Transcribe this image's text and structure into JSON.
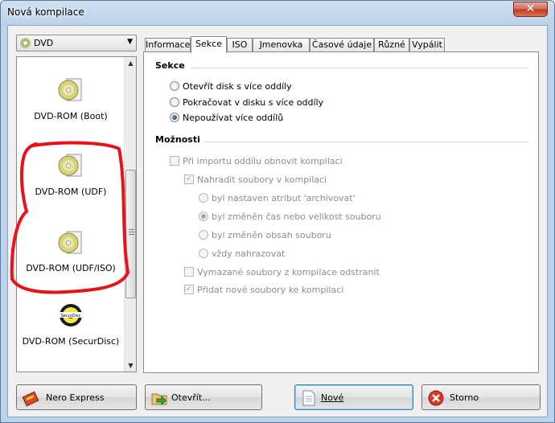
{
  "window": {
    "title": "Nová kompilace"
  },
  "left_panel": {
    "dropdown_value": "DVD",
    "items": [
      {
        "label": "DVD-ROM (Boot)",
        "icon": "dvd-disc-icon"
      },
      {
        "label": "DVD-ROM (UDF)",
        "icon": "dvd-disc-icon"
      },
      {
        "label": "DVD-ROM (UDF/ISO)",
        "icon": "dvd-disc-icon"
      },
      {
        "label": "DVD-ROM (SecurDisc)",
        "icon": "securdisc-icon",
        "icon_text": "SecurDisc"
      }
    ]
  },
  "tabs": [
    {
      "label": "Informace",
      "active": false
    },
    {
      "label": "Sekce",
      "active": true
    },
    {
      "label": "ISO",
      "active": false
    },
    {
      "label": "Jmenovka",
      "active": false
    },
    {
      "label": "Časové údaje",
      "active": false
    },
    {
      "label": "Různé",
      "active": false
    },
    {
      "label": "Vypálit",
      "active": false
    }
  ],
  "sekce": {
    "title": "Sekce",
    "options": [
      {
        "label": "Otevřít disk s více oddíly",
        "checked": false
      },
      {
        "label": "Pokračovat v disku s více oddíly",
        "checked": false
      },
      {
        "label": "Nepoužívat více oddílů",
        "checked": true
      }
    ]
  },
  "moznosti": {
    "title": "Možnosti",
    "import_checkbox": {
      "label": "Při importu oddílu obnovit kompilaci",
      "checked": false,
      "enabled": false
    },
    "replace_checkbox": {
      "label": "Nahradit soubory v kompilaci",
      "checked": true,
      "enabled": false
    },
    "replace_options": [
      {
        "label": "byl nastaven atribut 'archivovat'",
        "checked": false
      },
      {
        "label": "byl změněn čas nebo velikost souboru",
        "checked": true
      },
      {
        "label": "byl změněn obsah souboru",
        "checked": false
      },
      {
        "label": "vždy nahrazovat",
        "checked": false
      }
    ],
    "remove_checkbox": {
      "label": "Vymazané soubory z kompilace odstranit",
      "checked": false,
      "enabled": false
    },
    "add_checkbox": {
      "label": "Přidat nové soubory ke kompilaci",
      "checked": true,
      "enabled": false
    }
  },
  "buttons": {
    "nero_express": "Nero Express",
    "open": "Otevřít...",
    "new": "Nové",
    "cancel": "Storno"
  },
  "colors": {
    "annotation_red": "#e8121a",
    "title_bar": "#bcd2ea",
    "close_red": "#c7432b"
  }
}
